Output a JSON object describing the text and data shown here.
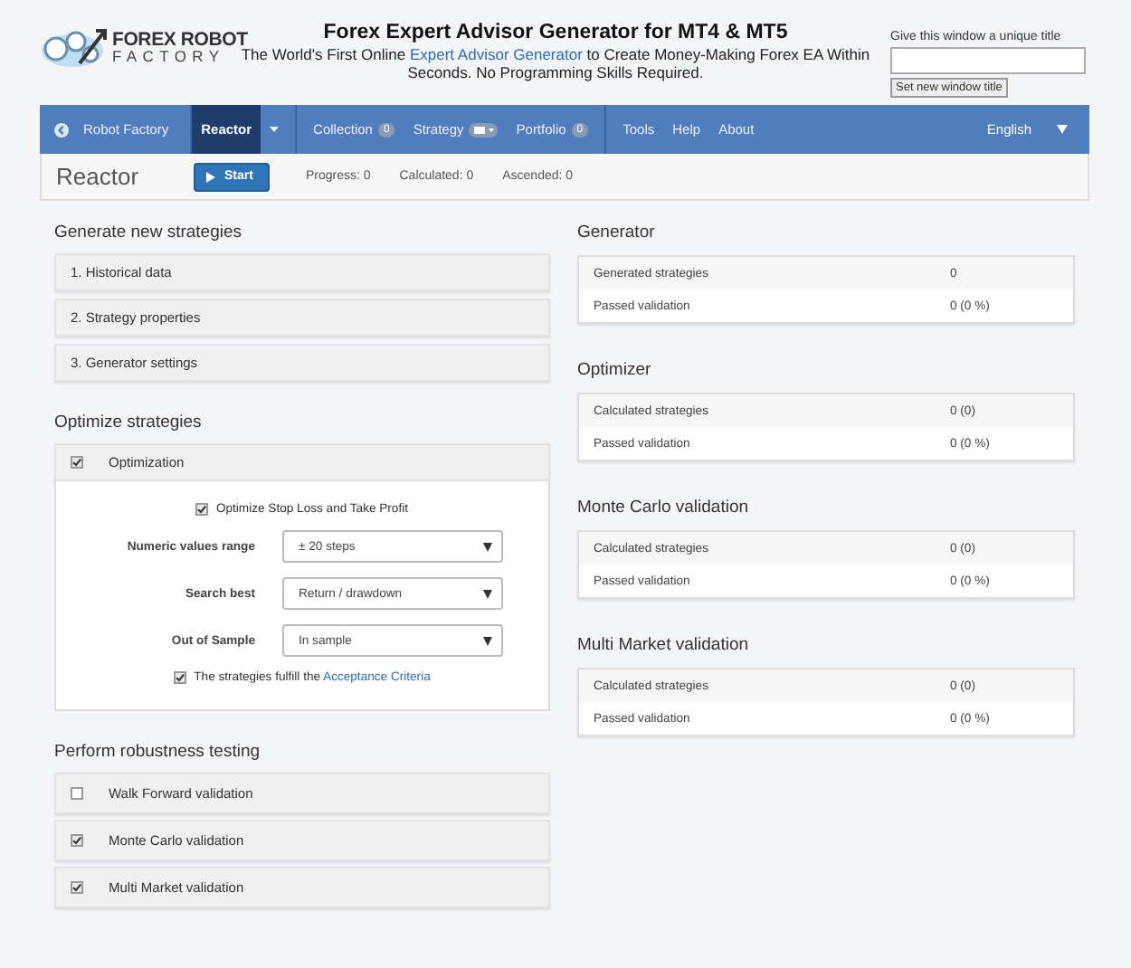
{
  "header": {
    "logo_top": "FOREX ROBOT",
    "logo_bottom": "FACTORY",
    "title": "Forex Expert Advisor Generator for MT4 & MT5",
    "subtitle_before": "The World's First Online ",
    "subtitle_link": "Expert Advisor Generator",
    "subtitle_after": " to Create Money-Making Forex EA Within Seconds. No Programming Skills Required."
  },
  "window_title": {
    "label": "Give this window a unique title",
    "button": "Set new window title"
  },
  "nav": {
    "home": "Robot Factory",
    "groups": [
      {
        "items": [
          {
            "kind": "link",
            "label": "Reactor",
            "selected": true
          },
          {
            "kind": "dropdown",
            "selected": false
          }
        ]
      },
      {
        "items": [
          {
            "kind": "link",
            "label": "Collection",
            "badge": "0",
            "selected": false
          },
          {
            "kind": "toggle",
            "label": "Strategy",
            "selected": false
          },
          {
            "kind": "link",
            "label": "Portfolio",
            "badge": "0",
            "selected": false
          }
        ]
      },
      {
        "items": [
          {
            "kind": "link",
            "label": "Tools",
            "selected": false
          },
          {
            "kind": "link",
            "label": "Help",
            "selected": false
          },
          {
            "kind": "link",
            "label": "About",
            "selected": false
          }
        ]
      }
    ],
    "language": "English"
  },
  "toolbar": {
    "title": "Reactor",
    "start": "Start",
    "stats": [
      "Progress: 0",
      "Calculated: 0",
      "Ascended: 0"
    ]
  },
  "generate": {
    "title": "Generate new strategies",
    "panels": [
      "1. Historical data",
      "2. Strategy properties",
      "3. Generator settings"
    ]
  },
  "optimize": {
    "title": "Optimize strategies",
    "panel": {
      "label": "Optimization",
      "checked": true
    },
    "options": [
      {
        "kind": "checkbox",
        "label": "Optimize Stop Loss and Take Profit",
        "checked": true
      },
      {
        "kind": "select",
        "label": "Numeric values range",
        "value": "± 20 steps"
      },
      {
        "kind": "select",
        "label": "Search best",
        "value": "Return / drawdown"
      },
      {
        "kind": "select",
        "label": "Out of Sample",
        "value": "In sample"
      },
      {
        "kind": "checkbox",
        "label": "The strategies fulfill the ",
        "link": "Acceptance Criteria",
        "checked": true
      }
    ]
  },
  "robustness": {
    "title": "Perform robustness testing",
    "panels": [
      {
        "label": "Walk Forward validation",
        "checked": false
      },
      {
        "label": "Monte Carlo validation",
        "checked": true
      },
      {
        "label": "Multi Market validation",
        "checked": true
      }
    ]
  },
  "stats": [
    {
      "title": "Generator",
      "rows": [
        {
          "label": "Generated strategies",
          "value": "0"
        },
        {
          "label": "Passed validation",
          "value": "0 (0 %)"
        }
      ]
    },
    {
      "title": "Optimizer",
      "rows": [
        {
          "label": "Calculated strategies",
          "value": "0 (0)"
        },
        {
          "label": "Passed validation",
          "value": "0 (0 %)"
        }
      ]
    },
    {
      "title": "Monte Carlo validation",
      "rows": [
        {
          "label": "Calculated strategies",
          "value": "0 (0)"
        },
        {
          "label": "Passed validation",
          "value": "0 (0 %)"
        }
      ]
    },
    {
      "title": "Multi Market validation",
      "rows": [
        {
          "label": "Calculated strategies",
          "value": "0 (0)"
        },
        {
          "label": "Passed validation",
          "value": "0 (0 %)"
        }
      ]
    }
  ]
}
